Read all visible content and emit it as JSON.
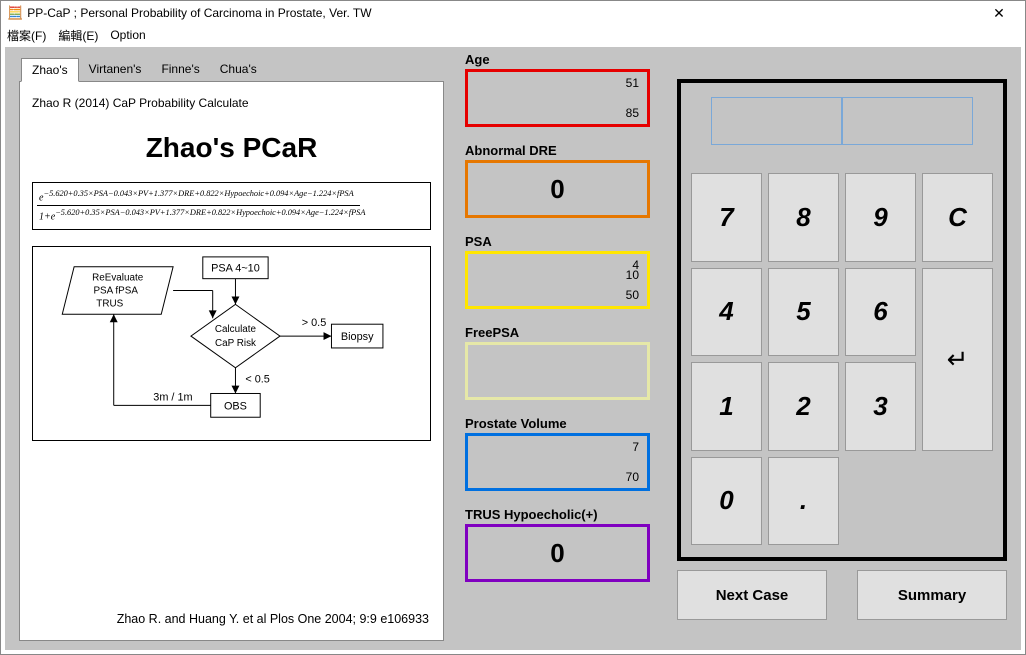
{
  "window": {
    "title": "PP-CaP ; Personal Probability of Carcinoma in Prostate, Ver. TW"
  },
  "menu": {
    "file": "檔案(F)",
    "edit": "編輯(E)",
    "option": "Option"
  },
  "tabs": {
    "zhao": "Zhao's",
    "virtanen": "Virtanen's",
    "finne": "Finne's",
    "chua": "Chua's"
  },
  "panel": {
    "ref": "Zhao R (2014) CaP Probability Calculate",
    "title": "Zhao's PCaR",
    "formula_num": "e^(-5.620+0.35×PSA−0.043×PV+1.377×DRE+0.822×Hypoechoic+0.094×Age−1.224×fPSA",
    "formula_den": "1+e^(-5.620+0.35×PSA−0.043×PV+1.377×DRE+0.822×Hypoechoic+0.094×Age−1.224×fPSA",
    "flow": {
      "psa_range": "PSA 4~10",
      "reeval_l1": "ReEvaluate",
      "reeval_l2": "PSA fPSA",
      "reeval_l3": "TRUS",
      "calc_l1": "Calculate",
      "calc_l2": "CaP Risk",
      "gt": "> 0.5",
      "lt": "< 0.5",
      "biopsy": "Biopsy",
      "obs": "OBS",
      "period": "3m / 1m"
    },
    "citation": "Zhao R.  and Huang Y. et al    Plos One 2004; 9:9 e106933"
  },
  "inputs": {
    "age": {
      "label": "Age",
      "min": "51",
      "max": "85"
    },
    "dre": {
      "label": "Abnormal DRE",
      "value": "0"
    },
    "psa": {
      "label": "PSA",
      "v1": "4",
      "v2": "10",
      "max": "50"
    },
    "fpsa": {
      "label": "FreePSA"
    },
    "pv": {
      "label": "Prostate Volume",
      "min": "7",
      "max": "70"
    },
    "trus": {
      "label": "TRUS Hypoecholic(+)",
      "value": "0"
    }
  },
  "keypad": {
    "k7": "7",
    "k8": "8",
    "k9": "9",
    "kc": "C",
    "k4": "4",
    "k5": "5",
    "k6": "6",
    "k1": "1",
    "k2": "2",
    "k3": "3",
    "k0": "0",
    "kdot": ".",
    "kenter": "↵"
  },
  "buttons": {
    "next": "Next Case",
    "summary": "Summary"
  }
}
